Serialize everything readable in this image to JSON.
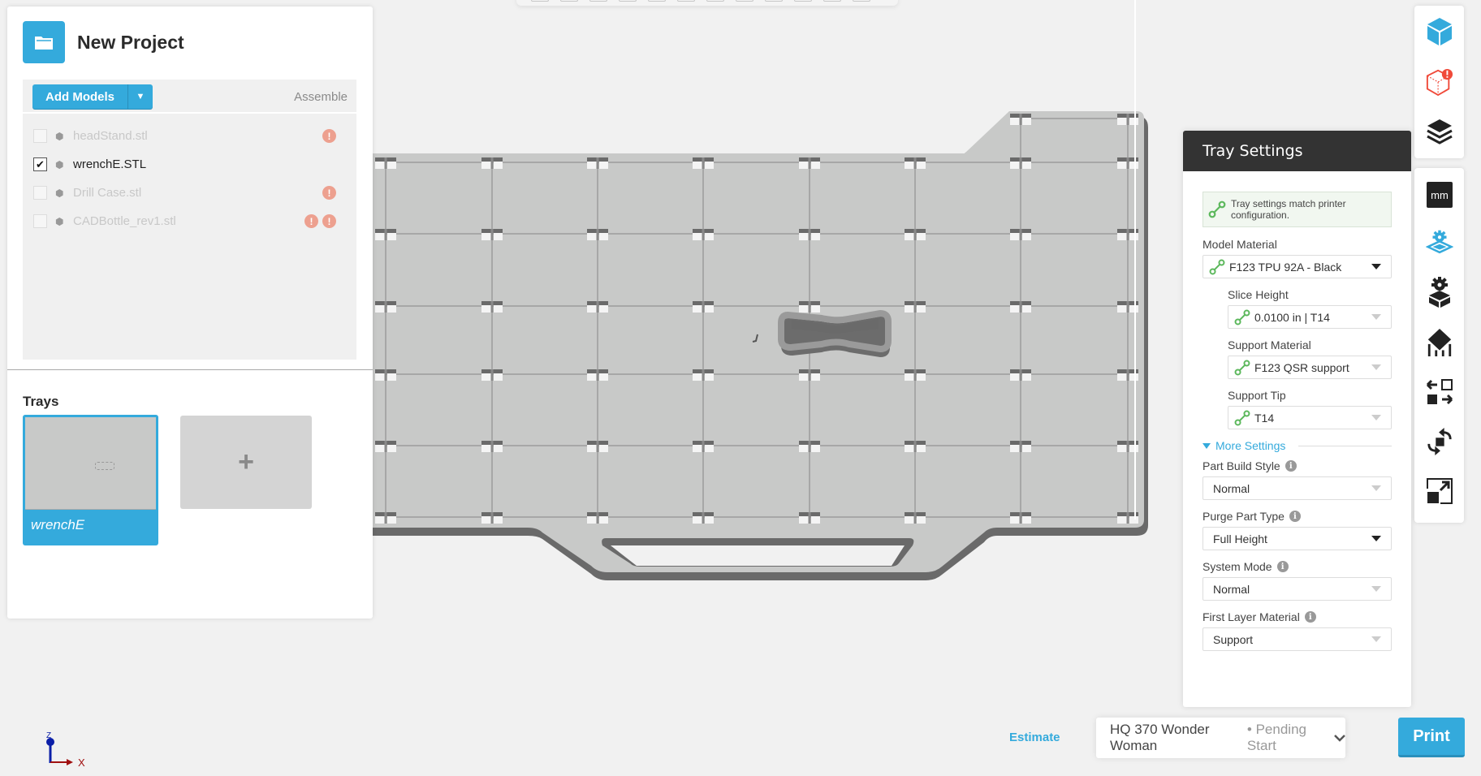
{
  "project": {
    "title": "New Project",
    "icon": "folder-icon"
  },
  "models_toolbar": {
    "add_models_label": "Add Models",
    "assemble_label": "Assemble"
  },
  "models": [
    {
      "name": "headStand.stl",
      "checked": false,
      "enabled": false,
      "warnings": 1
    },
    {
      "name": "wrenchE.STL",
      "checked": true,
      "enabled": true,
      "warnings": 0
    },
    {
      "name": "Drill Case.stl",
      "checked": false,
      "enabled": false,
      "warnings": 1
    },
    {
      "name": "CADBottle_rev1.stl",
      "checked": false,
      "enabled": false,
      "warnings": 2
    }
  ],
  "trays": {
    "title": "Trays",
    "items": [
      {
        "name": "wrenchE",
        "selected": true
      }
    ],
    "add_label": "+"
  },
  "tray_settings": {
    "title": "Tray Settings",
    "match_message": "Tray settings match printer configuration.",
    "model_material": {
      "label": "Model Material",
      "value": "F123 TPU 92A - Black"
    },
    "slice_height": {
      "label": "Slice Height",
      "value": "0.0100 in | T14"
    },
    "support_material": {
      "label": "Support Material",
      "value": "F123 QSR support"
    },
    "support_tip": {
      "label": "Support Tip",
      "value": "T14"
    },
    "more_settings_label": "More Settings",
    "part_build_style": {
      "label": "Part Build Style",
      "value": "Normal"
    },
    "purge_part_type": {
      "label": "Purge Part Type",
      "value": "Full Height"
    },
    "system_mode": {
      "label": "System Mode",
      "value": "Normal"
    },
    "first_layer_material": {
      "label": "First Layer Material",
      "value": "Support"
    }
  },
  "right_toolbar": {
    "top_group": [
      "model-cube-icon",
      "model-error-icon",
      "layers-icon"
    ],
    "bottom_group": [
      "units-mm-icon",
      "tray-settings-icon",
      "part-settings-icon",
      "orient-icon",
      "arrange-icon",
      "rotate-icon",
      "scale-icon"
    ],
    "units_label": "mm"
  },
  "bottom_bar": {
    "estimate_label": "Estimate",
    "printer_name": "HQ 370 Wonder Woman",
    "printer_status": "• Pending Start",
    "print_label": "Print"
  },
  "axis": {
    "x_label": "X",
    "z_label": "Z"
  },
  "colors": {
    "accent": "#34aadc",
    "header_dark": "#333333",
    "warning": "#eda08f",
    "error": "#f04a3a",
    "link_green": "#5cb85c",
    "tray_fill": "#c8c9c8"
  }
}
